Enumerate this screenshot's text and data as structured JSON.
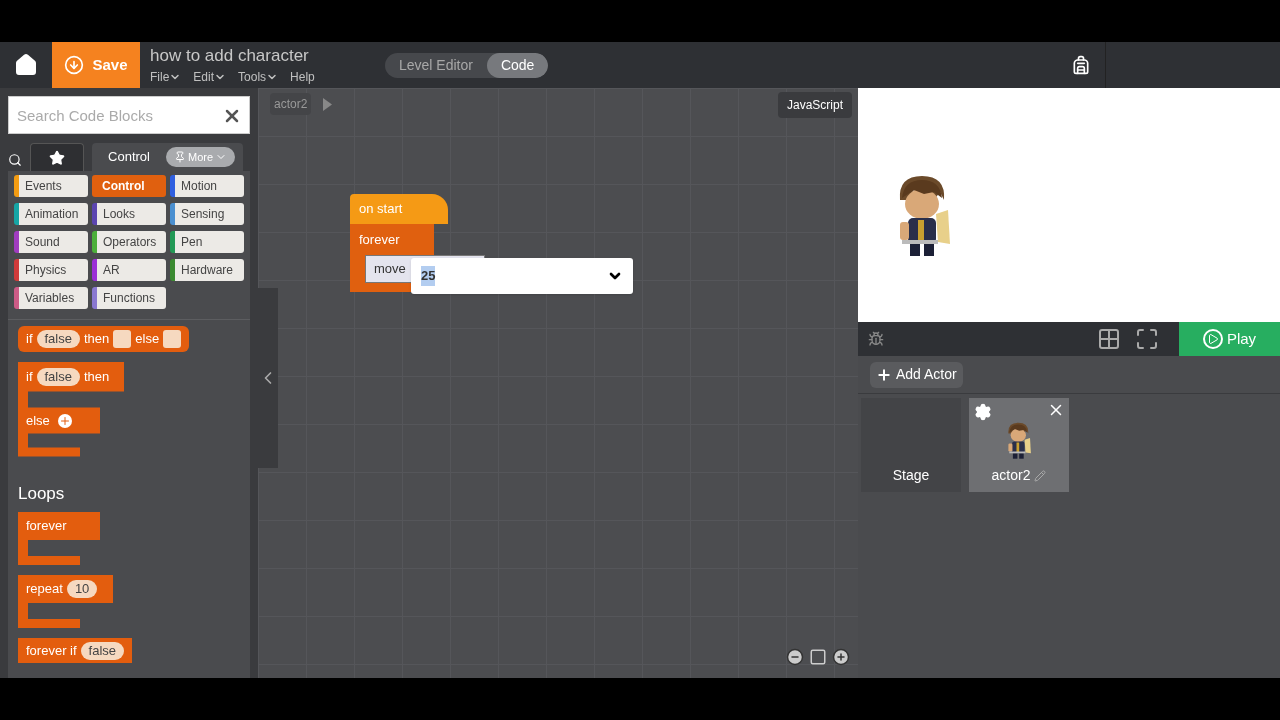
{
  "topbar": {
    "save": "Save",
    "title": "how to add character",
    "menus": [
      {
        "label": "File",
        "caret": true
      },
      {
        "label": "Edit",
        "caret": true
      },
      {
        "label": "Tools",
        "caret": true
      },
      {
        "label": "Help",
        "caret": false
      }
    ],
    "tabs": [
      {
        "label": "Level Editor",
        "selected": false
      },
      {
        "label": "Code",
        "selected": true
      }
    ]
  },
  "toolbox": {
    "search": {
      "placeholder": "Search Code Blocks"
    },
    "tabs": [
      {
        "kind": "star",
        "selected": false
      },
      {
        "kind": "label",
        "label": "Control",
        "selected": true
      }
    ],
    "more": "More",
    "categories": [
      {
        "label": "Events",
        "color": "#f39c12",
        "selected": false
      },
      {
        "label": "Control",
        "color": "#e0600f",
        "selected": true
      },
      {
        "label": "Motion",
        "color": "#2f5fe0",
        "selected": false
      },
      {
        "label": "Animation",
        "color": "#16a5a5",
        "selected": false
      },
      {
        "label": "Looks",
        "color": "#5b45b0",
        "selected": false
      },
      {
        "label": "Sensing",
        "color": "#4a8fd0",
        "selected": false
      },
      {
        "label": "Sound",
        "color": "#a03cc0",
        "selected": false
      },
      {
        "label": "Operators",
        "color": "#4caf3a",
        "selected": false
      },
      {
        "label": "Pen",
        "color": "#229955",
        "selected": false
      },
      {
        "label": "Physics",
        "color": "#d03a3a",
        "selected": false
      },
      {
        "label": "AR",
        "color": "#9b2fd6",
        "selected": false
      },
      {
        "label": "Hardware",
        "color": "#3a8a30",
        "selected": false
      },
      {
        "label": "Variables",
        "color": "#cc5b86",
        "selected": false
      },
      {
        "label": "Functions",
        "color": "#8a78d0",
        "selected": false
      }
    ],
    "sections": [
      {
        "blocks": [
          {
            "kind": "inline",
            "parts": [
              {
                "kind": "text",
                "text": "if"
              },
              {
                "kind": "bool",
                "text": "false"
              },
              {
                "kind": "text",
                "text": "then"
              },
              {
                "kind": "slot"
              },
              {
                "kind": "text",
                "text": "else"
              },
              {
                "kind": "slot"
              }
            ]
          },
          {
            "kind": "c-else",
            "parts": [
              {
                "kind": "text",
                "text": "if"
              },
              {
                "kind": "bool",
                "text": "false"
              },
              {
                "kind": "text",
                "text": "then"
              }
            ],
            "else_label": "else"
          }
        ]
      },
      {
        "heading": "Loops",
        "blocks": [
          {
            "kind": "c",
            "parts": [
              {
                "kind": "text",
                "text": "forever"
              }
            ]
          },
          {
            "kind": "c",
            "parts": [
              {
                "kind": "text",
                "text": "repeat"
              },
              {
                "kind": "num",
                "text": "10"
              }
            ]
          },
          {
            "kind": "cut",
            "parts": [
              {
                "kind": "text",
                "text": "forever if"
              },
              {
                "kind": "bool",
                "text": "false"
              }
            ]
          }
        ]
      }
    ]
  },
  "workspace": {
    "breadcrumb": "actor2",
    "language": "JavaScript",
    "hat": "on start",
    "loop": "forever",
    "statement": "move",
    "dropdown": {
      "value": "25"
    }
  },
  "stage": {
    "play": "Play",
    "add_actor": "Add Actor",
    "actors": [
      {
        "name": "Stage",
        "kind": "stage",
        "selected": false
      },
      {
        "name": "actor2",
        "kind": "sprite",
        "selected": true
      }
    ]
  }
}
